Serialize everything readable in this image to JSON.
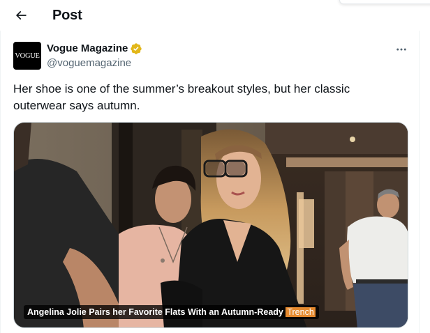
{
  "header": {
    "title": "Post",
    "back_icon": "arrow-left-icon"
  },
  "tweet": {
    "author": {
      "avatar_text": "VOGUE",
      "name": "Vogue Magazine",
      "handle": "@voguemagazine",
      "verified_icon": "verified-badge-icon",
      "verified_color": "#e2b719"
    },
    "more_icon": "more-horizontal-icon",
    "text": "Her shoe is one of the summer’s breakout styles, but her classic outerwear says autumn.",
    "media": {
      "caption_main": "Angelina Jolie Pairs her Favorite Flats With an Autumn-Ready ",
      "caption_highlight": "Trench",
      "highlight_color": "#e58a2f"
    }
  },
  "colors": {
    "text_primary": "#0f1419",
    "text_secondary": "#536471",
    "border": "#cfd9de"
  }
}
